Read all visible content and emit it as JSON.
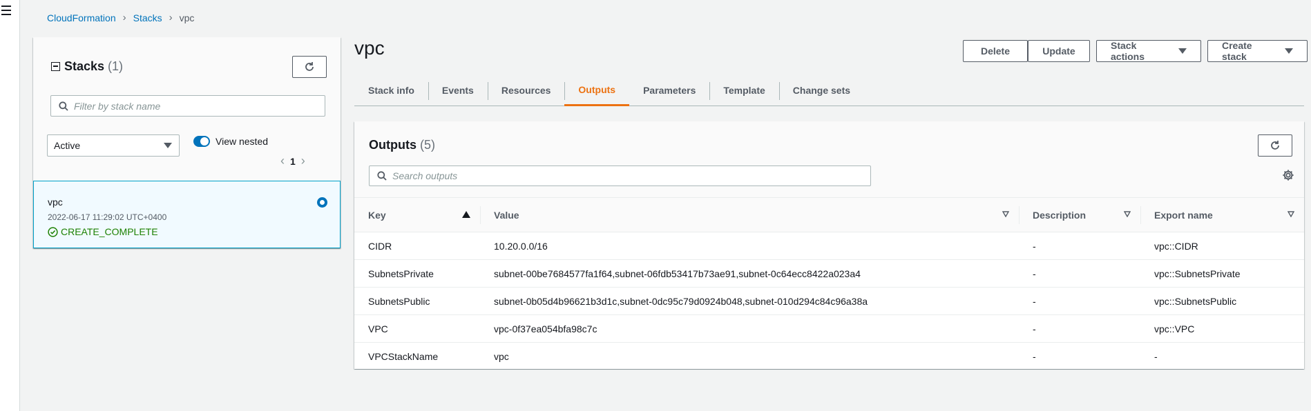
{
  "breadcrumb": {
    "items": [
      "CloudFormation",
      "Stacks"
    ],
    "current": "vpc"
  },
  "stacks_panel": {
    "title": "Stacks",
    "count": "(1)",
    "search_placeholder": "Filter by stack name",
    "filter_value": "Active",
    "toggle_label": "View nested",
    "toggle_on": true,
    "page": "1",
    "stack": {
      "name": "vpc",
      "date": "2022-06-17 11:29:02 UTC+0400",
      "status": "CREATE_COMPLETE",
      "selected": true
    }
  },
  "header": {
    "title": "vpc",
    "buttons": {
      "delete": "Delete",
      "update": "Update",
      "stack_actions": "Stack actions",
      "create_stack": "Create stack"
    }
  },
  "tabs": [
    "Stack info",
    "Events",
    "Resources",
    "Outputs",
    "Parameters",
    "Template",
    "Change sets"
  ],
  "active_tab": "Outputs",
  "outputs": {
    "title": "Outputs",
    "count": "(5)",
    "search_placeholder": "Search outputs",
    "columns": [
      "Key",
      "Value",
      "Description",
      "Export name"
    ],
    "rows": [
      [
        "CIDR",
        "10.20.0.0/16",
        "-",
        "vpc::CIDR"
      ],
      [
        "SubnetsPrivate",
        "subnet-00be7684577fa1f64,subnet-06fdb53417b73ae91,subnet-0c64ecc8422a023a4",
        "-",
        "vpc::SubnetsPrivate"
      ],
      [
        "SubnetsPublic",
        "subnet-0b05d4b96621b3d1c,subnet-0dc95c79d0924b048,subnet-010d294c84c96a38a",
        "-",
        "vpc::SubnetsPublic"
      ],
      [
        "VPC",
        "vpc-0f37ea054bfa98c7c",
        "-",
        "vpc::VPC"
      ],
      [
        "VPCStackName",
        "vpc",
        "-",
        "-"
      ]
    ]
  },
  "colors": {
    "link": "#0073bb",
    "active_tab": "#ec7211",
    "success": "#1d8102",
    "selected_border": "#00a1c9"
  }
}
